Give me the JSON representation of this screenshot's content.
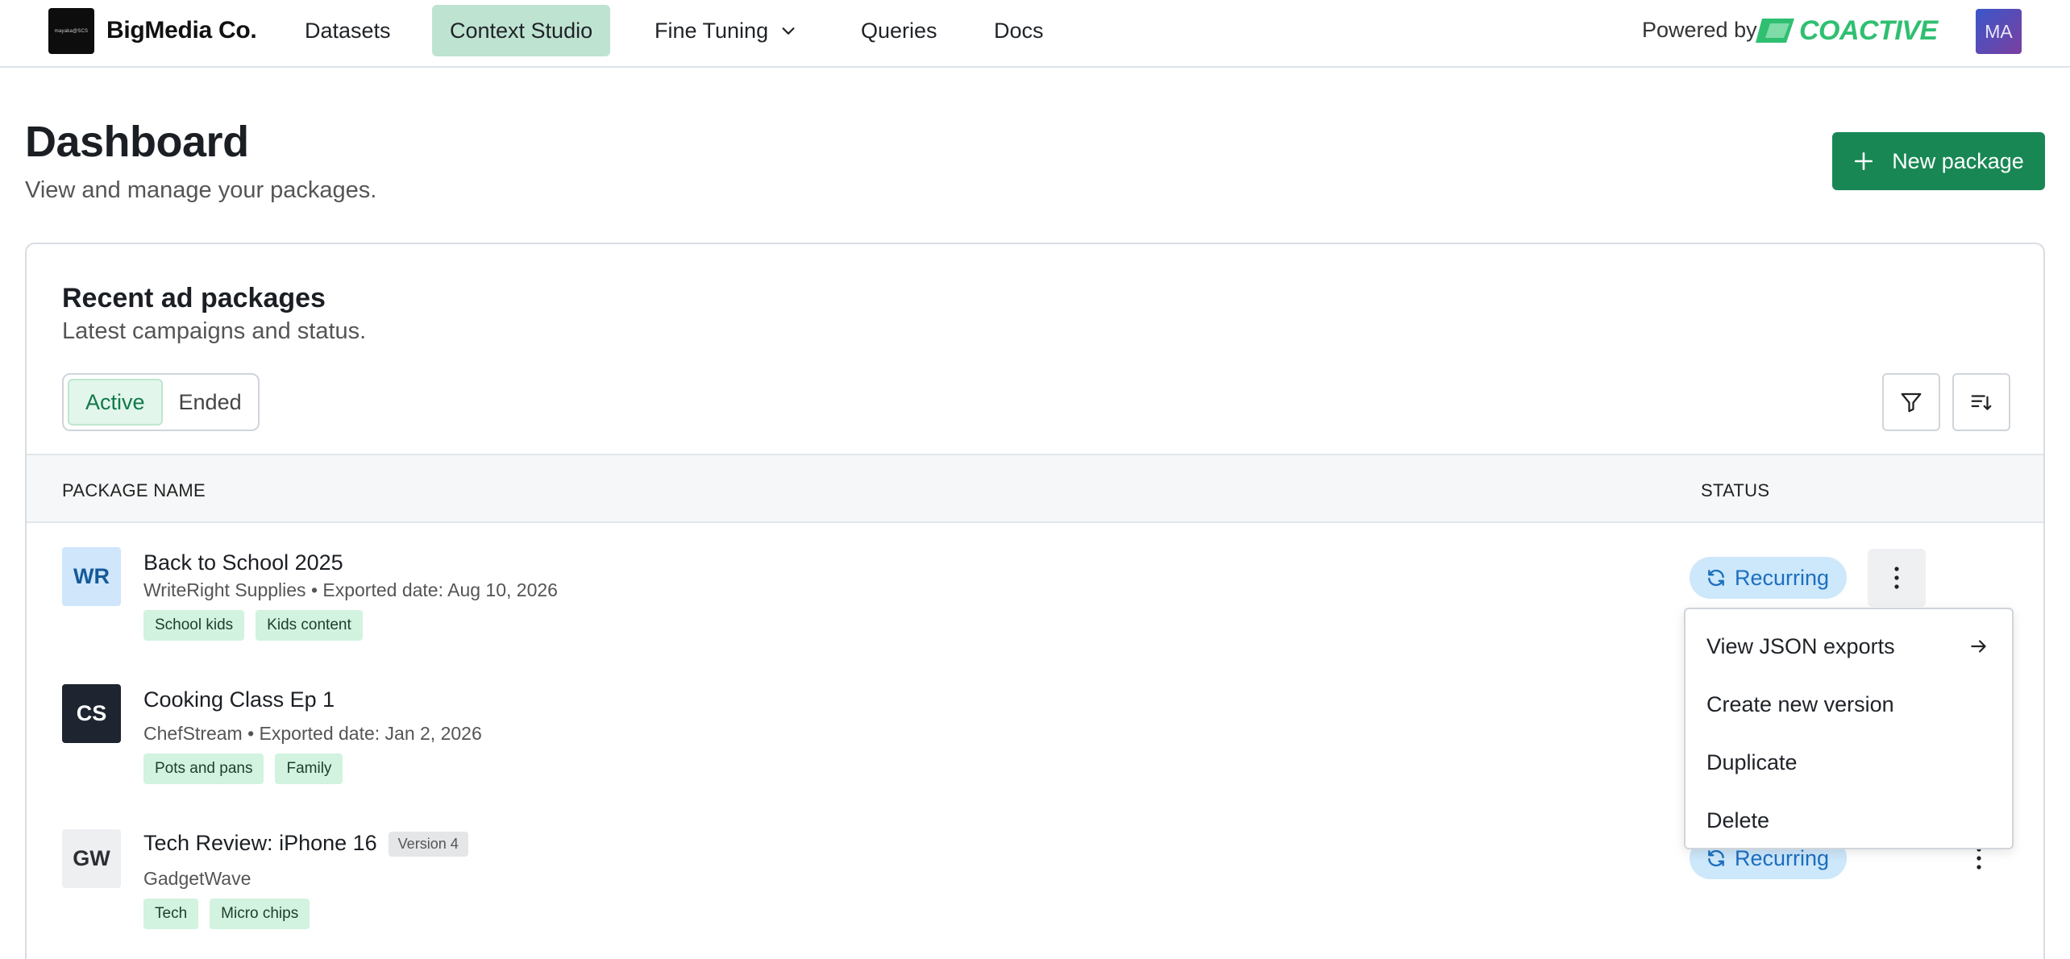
{
  "nav": {
    "logo_text": "mayaka@SCS",
    "brand": "BigMedia Co.",
    "items": [
      {
        "label": "Datasets"
      },
      {
        "label": "Context Studio"
      },
      {
        "label": "Fine Tuning"
      },
      {
        "label": "Queries"
      },
      {
        "label": "Docs"
      }
    ],
    "powered_by": "Powered by",
    "partner": "COACTIVE",
    "partner_color": "#2fbf71",
    "user_initials": "MA"
  },
  "header": {
    "title": "Dashboard",
    "subtitle": "View and manage your packages.",
    "new_button": "New package"
  },
  "card": {
    "title": "Recent ad packages",
    "subtitle": "Latest campaigns and status.",
    "segments": [
      "Active",
      "Ended"
    ],
    "columns": {
      "name": "PACKAGE NAME",
      "status": "STATUS"
    },
    "rows": [
      {
        "initials": "WR",
        "name": "Back to School 2025",
        "meta": "WriteRight Supplies •  Exported date: Aug 10, 2026",
        "tags": [
          "School kids",
          "Kids content"
        ],
        "status": "Recurring"
      },
      {
        "initials": "CS",
        "name": "Cooking Class Ep 1",
        "meta": "ChefStream • Exported date: Jan 2, 2026",
        "tags": [
          "Pots and pans",
          "Family"
        ],
        "status": ""
      },
      {
        "initials": "GW",
        "name": "Tech Review: iPhone 16",
        "version": "Version 4",
        "meta": "GadgetWave",
        "tags": [
          "Tech",
          "Micro chips"
        ],
        "status": "Recurring"
      }
    ]
  },
  "menu": {
    "items": [
      "View JSON exports",
      "Create new version",
      "Duplicate",
      "Delete"
    ]
  },
  "colors": {
    "primary": "#198754",
    "nav_active": "#bfe3d1",
    "status_bg": "#cde7fb",
    "status_text": "#1b6fbf",
    "tag_bg": "#d1f3df"
  },
  "icons": [
    "chevron-down-icon",
    "plus-icon",
    "filter-icon",
    "sort-icon",
    "refresh-icon",
    "kebab-icon",
    "arrow-right-icon"
  ]
}
